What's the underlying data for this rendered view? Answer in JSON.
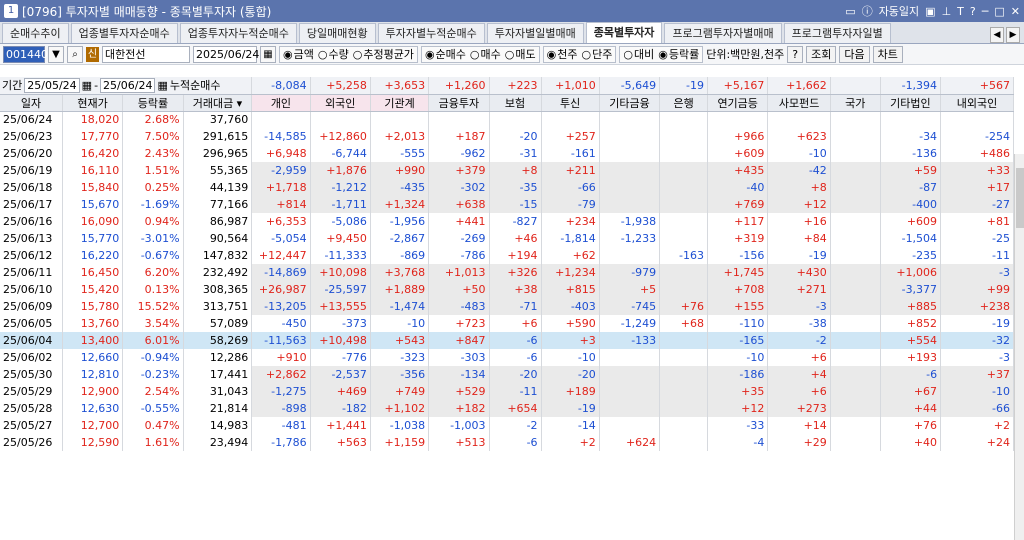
{
  "titlebar": {
    "num": "1",
    "title": "[0796] 투자자별 매매동향 - 종목별투자자 (통합)",
    "auto_journal": "자동일지",
    "icons": [
      "window-icon",
      "help-icon",
      "text-icon",
      "question-icon",
      "minimize-icon",
      "maximize-icon",
      "close-icon"
    ]
  },
  "tabs": [
    "순매수추이",
    "업종별투자자순매수",
    "업종투자자누적순매수",
    "당일매매현황",
    "투자자별누적순매수",
    "투자자별일별매매",
    "종목별투자자",
    "프로그램투자자별매매",
    "프로그램투자자일별"
  ],
  "active_tab": "종목별투자자",
  "toolbar": {
    "code": "001440",
    "sin": "신",
    "name": "대한전선",
    "date": "2025/06/24",
    "r1": [
      "금액",
      "수량",
      "추정평균가"
    ],
    "r2": [
      "순매수",
      "매수",
      "매도"
    ],
    "r3": [
      "천주",
      "단주"
    ],
    "r4": [
      "대비",
      "등락률"
    ],
    "unit": "단위:백만원,천주",
    "btn_help": "?",
    "btn_query": "조회",
    "btn_next": "다음",
    "btn_chart": "차트"
  },
  "period": {
    "label": "기간",
    "from": "25/05/24",
    "to": "25/06/24",
    "cum_label": "누적순매수"
  },
  "summary": [
    "-8,084",
    "+5,258",
    "+3,653",
    "+1,260",
    "+223",
    "+1,010",
    "-5,649",
    "-19",
    "+5,167",
    "+1,662",
    "",
    "-1,394",
    "+567"
  ],
  "headers": [
    "일자",
    "현재가",
    "등락률",
    "거래대금",
    "개인",
    "외국인",
    "기관계",
    "금융투자",
    "보험",
    "투신",
    "기타금융",
    "은행",
    "연기금등",
    "사모펀드",
    "국가",
    "기타법인",
    "내외국인"
  ],
  "rows": [
    [
      "25/06/24",
      "18,020",
      "2.68%",
      "37,760",
      "",
      "",
      "",
      "",
      "",
      "",
      "",
      "",
      "",
      "",
      "",
      "",
      ""
    ],
    [
      "25/06/23",
      "17,770",
      "7.50%",
      "291,615",
      "-14,585",
      "+12,860",
      "+2,013",
      "+187",
      "-20",
      "+257",
      "",
      "",
      "+966",
      "+623",
      "",
      "-34",
      "-254"
    ],
    [
      "25/06/20",
      "16,420",
      "2.43%",
      "296,965",
      "+6,948",
      "-6,744",
      "-555",
      "-962",
      "-31",
      "-161",
      "",
      "",
      "+609",
      "-10",
      "",
      "-136",
      "+486"
    ],
    [
      "25/06/19",
      "16,110",
      "1.51%",
      "55,365",
      "-2,959",
      "+1,876",
      "+990",
      "+379",
      "+8",
      "+211",
      "",
      "",
      "+435",
      "-42",
      "",
      "+59",
      "+33"
    ],
    [
      "25/06/18",
      "15,840",
      "0.25%",
      "44,139",
      "+1,718",
      "-1,212",
      "-435",
      "-302",
      "-35",
      "-66",
      "",
      "",
      "-40",
      "+8",
      "",
      "-87",
      "+17"
    ],
    [
      "25/06/17",
      "15,670",
      "-1.69%",
      "77,166",
      "+814",
      "-1,711",
      "+1,324",
      "+638",
      "-15",
      "-79",
      "",
      "",
      "+769",
      "+12",
      "",
      "-400",
      "-27"
    ],
    [
      "25/06/16",
      "16,090",
      "0.94%",
      "86,987",
      "+6,353",
      "-5,086",
      "-1,956",
      "+441",
      "-827",
      "+234",
      "-1,938",
      "",
      "+117",
      "+16",
      "",
      "+609",
      "+81"
    ],
    [
      "25/06/13",
      "15,770",
      "-3.01%",
      "90,564",
      "-5,054",
      "+9,450",
      "-2,867",
      "-269",
      "+46",
      "-1,814",
      "-1,233",
      "",
      "+319",
      "+84",
      "",
      "-1,504",
      "-25"
    ],
    [
      "25/06/12",
      "16,220",
      "-0.67%",
      "147,832",
      "+12,447",
      "-11,333",
      "-869",
      "-786",
      "+194",
      "+62",
      "",
      "-163",
      "-156",
      "-19",
      "",
      "-235",
      "-11"
    ],
    [
      "25/06/11",
      "16,450",
      "6.20%",
      "232,492",
      "-14,869",
      "+10,098",
      "+3,768",
      "+1,013",
      "+326",
      "+1,234",
      "-979",
      "",
      "+1,745",
      "+430",
      "",
      "+1,006",
      "-3"
    ],
    [
      "25/06/10",
      "15,420",
      "0.13%",
      "308,365",
      "+26,987",
      "-25,597",
      "+1,889",
      "+50",
      "+38",
      "+815",
      "+5",
      "",
      "+708",
      "+271",
      "",
      "-3,377",
      "+99"
    ],
    [
      "25/06/09",
      "15,780",
      "15.52%",
      "313,751",
      "-13,205",
      "+13,555",
      "-1,474",
      "-483",
      "-71",
      "-403",
      "-745",
      "+76",
      "+155",
      "-3",
      "",
      "+885",
      "+238"
    ],
    [
      "25/06/05",
      "13,760",
      "3.54%",
      "57,089",
      "-450",
      "-373",
      "-10",
      "+723",
      "+6",
      "+590",
      "-1,249",
      "+68",
      "-110",
      "-38",
      "",
      "+852",
      "-19"
    ],
    [
      "25/06/04",
      "13,400",
      "6.01%",
      "58,269",
      "-11,563",
      "+10,498",
      "+543",
      "+847",
      "-6",
      "+3",
      "-133",
      "",
      "-165",
      "-2",
      "",
      "+554",
      "-32"
    ],
    [
      "25/06/02",
      "12,660",
      "-0.94%",
      "12,286",
      "+910",
      "-776",
      "-323",
      "-303",
      "-6",
      "-10",
      "",
      "",
      "-10",
      "+6",
      "",
      "+193",
      "-3"
    ],
    [
      "25/05/30",
      "12,810",
      "-0.23%",
      "17,441",
      "+2,862",
      "-2,537",
      "-356",
      "-134",
      "-20",
      "-20",
      "",
      "",
      "-186",
      "+4",
      "",
      "-6",
      "+37"
    ],
    [
      "25/05/29",
      "12,900",
      "2.54%",
      "31,043",
      "-1,275",
      "+469",
      "+749",
      "+529",
      "-11",
      "+189",
      "",
      "",
      "+35",
      "+6",
      "",
      "+67",
      "-10"
    ],
    [
      "25/05/28",
      "12,630",
      "-0.55%",
      "21,814",
      "-898",
      "-182",
      "+1,102",
      "+182",
      "+654",
      "-19",
      "",
      "",
      "+12",
      "+273",
      "",
      "+44",
      "-66"
    ],
    [
      "25/05/27",
      "12,700",
      "0.47%",
      "14,983",
      "-481",
      "+1,441",
      "-1,038",
      "-1,003",
      "-2",
      "-14",
      "",
      "",
      "-33",
      "+14",
      "",
      "+76",
      "+2"
    ],
    [
      "25/05/26",
      "12,590",
      "1.61%",
      "23,494",
      "-1,786",
      "+563",
      "+1,159",
      "+513",
      "-6",
      "+2",
      "+624",
      "",
      "-4",
      "+29",
      "",
      "+40",
      "+24"
    ]
  ],
  "colors": {
    "up": "#e0241b",
    "down": "#1d4fd2",
    "title_bg": "#5b74ad"
  }
}
